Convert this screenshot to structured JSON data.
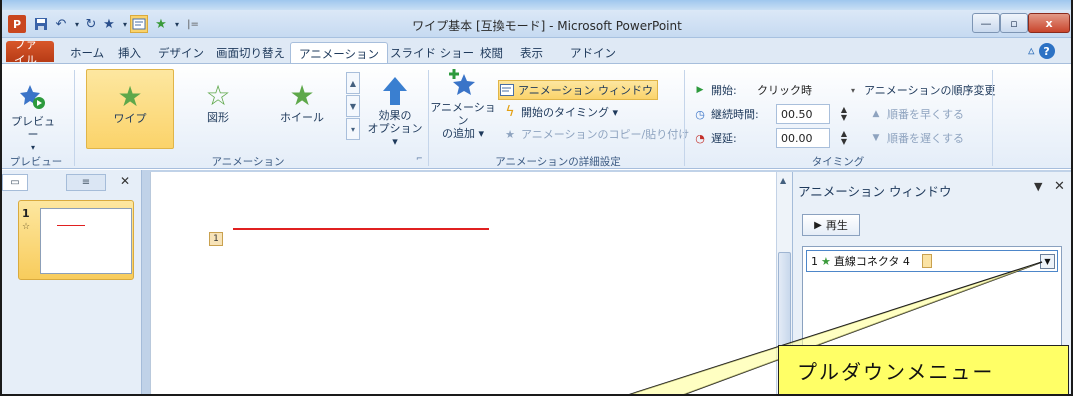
{
  "window": {
    "title": "ワイプ基本 [互換モード] - Microsoft PowerPoint",
    "controls": {
      "minimize": "—",
      "maximize": "▫",
      "close": "x"
    }
  },
  "quick_access": {
    "logo": "P",
    "save_icon": "save-icon",
    "undo_icon": "undo-icon",
    "redo_icon": "redo-icon"
  },
  "tabs": [
    {
      "label": "ファイル"
    },
    {
      "label": "ホーム"
    },
    {
      "label": "挿入"
    },
    {
      "label": "デザイン"
    },
    {
      "label": "画面切り替え"
    },
    {
      "label": "アニメーション"
    },
    {
      "label": "スライド ショー"
    },
    {
      "label": "校閲"
    },
    {
      "label": "表示"
    },
    {
      "label": "アドイン"
    }
  ],
  "ribbon": {
    "preview": {
      "button": "プレビュー",
      "group": "プレビュー"
    },
    "animation": {
      "items": [
        {
          "label": "ワイプ"
        },
        {
          "label": "図形"
        },
        {
          "label": "ホイール"
        }
      ],
      "effect_options_line1": "効果の",
      "effect_options_line2": "オプション ▾",
      "group": "アニメーション"
    },
    "advanced": {
      "add_line1": "アニメーション",
      "add_line2": "の追加 ▾",
      "pane_button": "アニメーション ウィンドウ",
      "trigger": "開始のタイミング ▾",
      "painter": "アニメーションのコピー/貼り付け",
      "group": "アニメーションの詳細設定"
    },
    "timing": {
      "start_label": "開始:",
      "start_value": "クリック時",
      "duration_label": "継続時間:",
      "duration_value": "00.50",
      "delay_label": "遅延:",
      "delay_value": "00.00",
      "reorder_title": "アニメーションの順序変更",
      "move_earlier": "順番を早くする",
      "move_later": "順番を遅くする",
      "group": "タイミング"
    }
  },
  "slides_panel": {
    "slide_number": "1",
    "anim_mark": "☆"
  },
  "slide": {
    "anim_tag": "1"
  },
  "anim_pane": {
    "title": "アニメーション ウィンドウ",
    "play": "再生",
    "item": {
      "order": "1",
      "name": "直線コネクタ 4"
    }
  },
  "callout": {
    "text": "プルダウンメニュー"
  },
  "colors": {
    "accent_file_tab": "#c5461c",
    "callout_fill": "#ffff66",
    "line_red": "#e02020",
    "highlight": "#fbd36a"
  }
}
